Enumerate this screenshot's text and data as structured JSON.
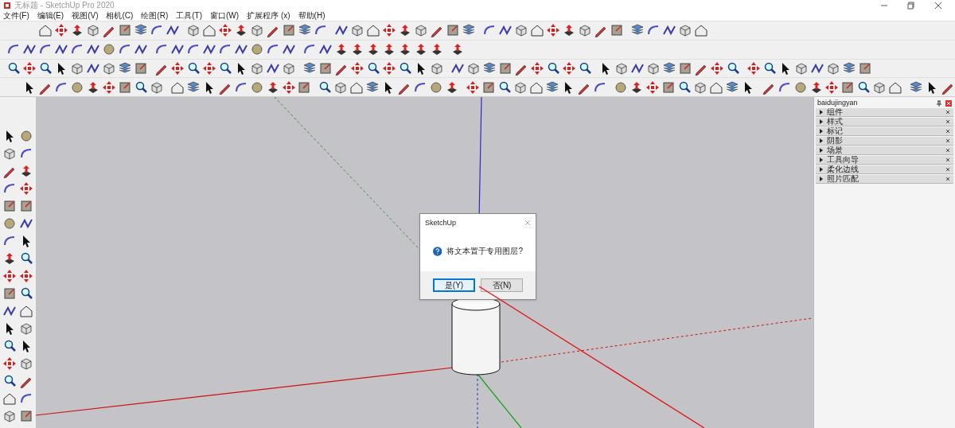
{
  "window": {
    "title": "无标题 - SketchUp Pro 2020"
  },
  "menu": [
    "文件(F)",
    "编辑(E)",
    "视图(V)",
    "相机(C)",
    "绘图(R)",
    "工具(T)",
    "窗口(W)",
    "扩展程序 (x)",
    "帮助(H)"
  ],
  "tray": {
    "title": "baidujingyan",
    "panels": [
      {
        "label": "组件",
        "expanded": false
      },
      {
        "label": "样式",
        "expanded": false
      },
      {
        "label": "标记",
        "expanded": false
      },
      {
        "label": "阴影",
        "expanded": false
      },
      {
        "label": "场景",
        "expanded": false
      },
      {
        "label": "工具向导",
        "expanded": false
      },
      {
        "label": "柔化边线",
        "expanded": false
      },
      {
        "label": "照片匹配",
        "expanded": false
      }
    ]
  },
  "dialog": {
    "title": "SketchUp",
    "message": "将文本置于专用图层?",
    "buttons": [
      {
        "label": "是(Y)",
        "selected": true
      },
      {
        "label": "否(N)",
        "selected": false
      }
    ]
  }
}
